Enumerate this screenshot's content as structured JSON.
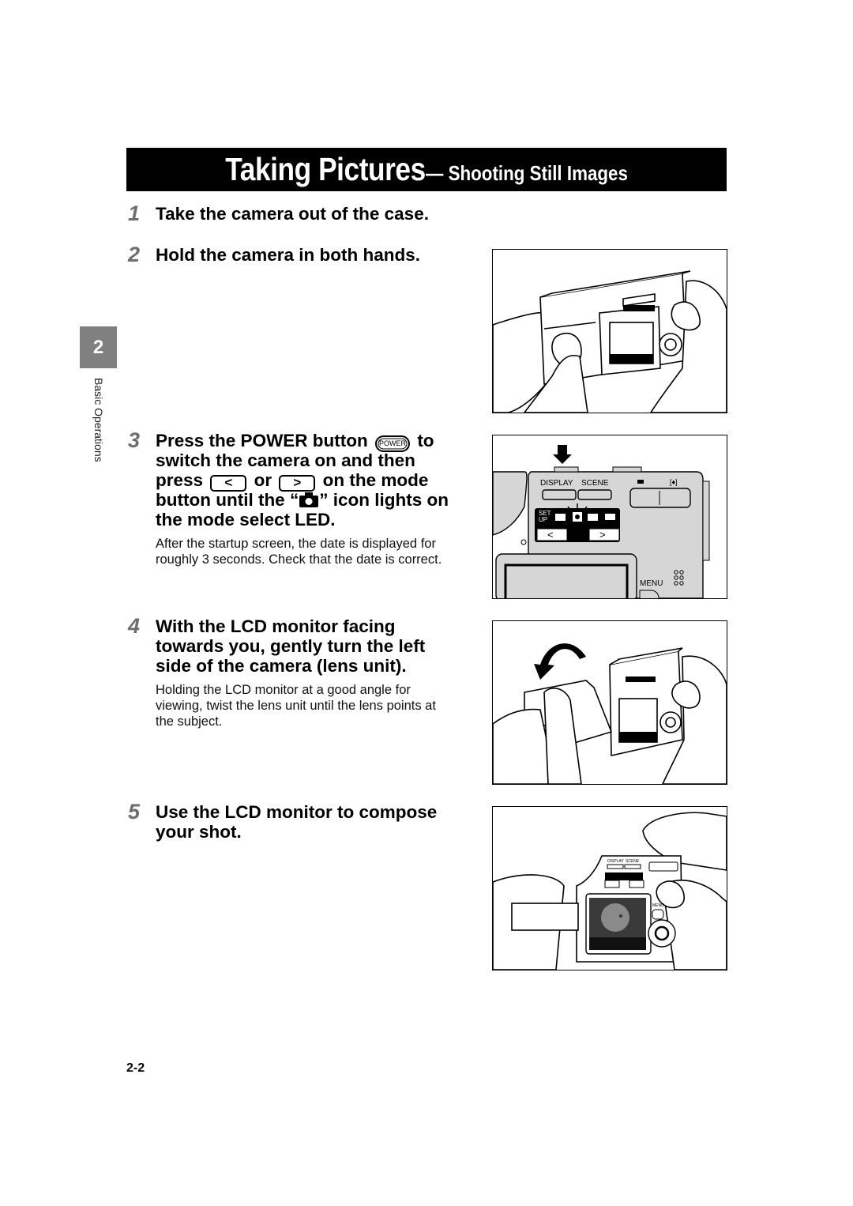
{
  "header": {
    "title_main": "Taking Pictures",
    "title_sub": " — Shooting Still Images"
  },
  "chapter": {
    "number": "2",
    "label": "Basic Operations"
  },
  "steps": [
    {
      "num": "1",
      "title": "Take the camera out of the case."
    },
    {
      "num": "2",
      "title": "Hold the camera in both hands."
    },
    {
      "num": "3",
      "line1_a": "Press the POWER button",
      "power_key": "POWER",
      "line1_b": "to",
      "line2": "switch the camera on and then",
      "line3_a": "press",
      "left_key": "<",
      "line3_or": "or",
      "right_key": ">",
      "line3_b": "on the mode",
      "line4_a": "button until the “",
      "line4_b": "” icon lights on",
      "line5": "the mode select LED.",
      "body": [
        "After the startup screen, the date is displayed for",
        "roughly 3 seconds. Check that the date is correct."
      ]
    },
    {
      "num": "4",
      "title_lines": [
        "With the LCD monitor facing",
        "towards you, gently turn the left",
        "side of the camera (lens unit)."
      ],
      "body": [
        "Holding the LCD monitor at a good angle for",
        "viewing, twist the lens unit until the lens points at",
        "the subject."
      ]
    },
    {
      "num": "5",
      "title_lines": [
        "Use the LCD monitor to compose",
        "your shot."
      ]
    }
  ],
  "figures": {
    "mode_panel": {
      "display_label": "DISPLAY",
      "scene_label": "SCENE",
      "setup_label_1": "SET",
      "setup_label_2": "UP",
      "menu_label": "MENU",
      "left_arrow": "<",
      "right_arrow": ">"
    },
    "compose": {
      "display_label": "DISPLAY",
      "scene_label": "SCENE",
      "menu_label": "MENU"
    }
  },
  "footer": {
    "page_number": "2-2"
  }
}
